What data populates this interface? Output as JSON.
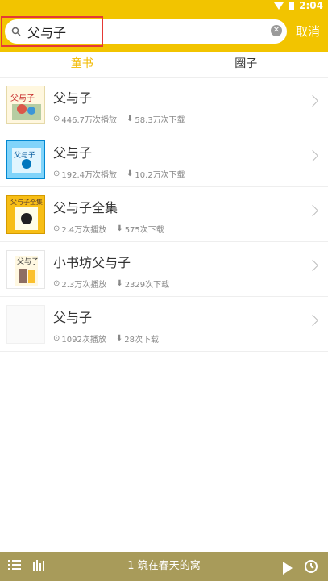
{
  "status_bar": {
    "time": "2:04"
  },
  "search": {
    "query": "父与子",
    "cancel_label": "取消"
  },
  "tabs": [
    {
      "label": "童书"
    },
    {
      "label": "圈子"
    }
  ],
  "results": [
    {
      "title": "父与子",
      "plays": "446.7万次播放",
      "downloads": "58.3万次下载",
      "cover_text": "父与子"
    },
    {
      "title": "父与子",
      "plays": "192.4万次播放",
      "downloads": "10.2万次下载",
      "cover_text": "父与子"
    },
    {
      "title": "父与子全集",
      "plays": "2.4万次播放",
      "downloads": "575次下载",
      "cover_text": "父与子全集"
    },
    {
      "title": "小书坊父与子",
      "plays": "2.3万次播放",
      "downloads": "2329次下载",
      "cover_text": "父与子"
    },
    {
      "title": "父与子",
      "plays": "1092次播放",
      "downloads": "28次下载",
      "cover_text": ""
    }
  ],
  "player": {
    "track": "1 筑在春天的窝"
  },
  "colors": {
    "accent": "#f2c400",
    "active_tab": "#f2b900",
    "player_bg": "#a89b5a",
    "focus_outline": "#e53935"
  }
}
